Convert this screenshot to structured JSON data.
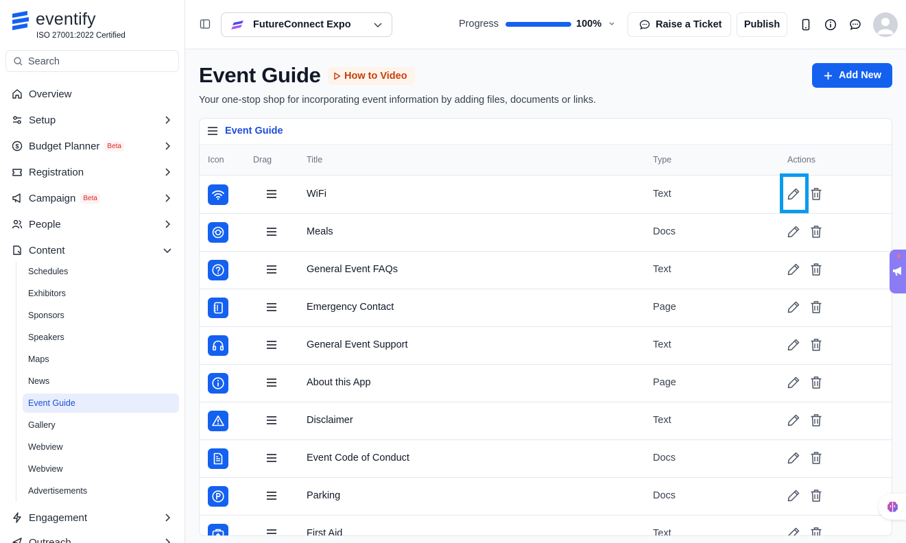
{
  "brand": {
    "name": "eventify",
    "tagline": "ISO 27001:2022 Certified",
    "color": "#1461f0"
  },
  "search": {
    "placeholder": "Search"
  },
  "nav": [
    {
      "label": "Overview",
      "icon": "home-icon",
      "chevron": false
    },
    {
      "label": "Setup",
      "icon": "sliders-icon",
      "chevron": true
    },
    {
      "label": "Budget Planner",
      "icon": "dollar-icon",
      "chevron": true,
      "badge": "Beta"
    },
    {
      "label": "Registration",
      "icon": "ticket-icon",
      "chevron": true
    },
    {
      "label": "Campaign",
      "icon": "megaphone-icon",
      "chevron": true,
      "badge": "Beta"
    },
    {
      "label": "People",
      "icon": "users-icon",
      "chevron": true
    },
    {
      "label": "Content",
      "icon": "file-icon",
      "chevron": true,
      "expanded": true
    },
    {
      "label": "Engagement",
      "icon": "bolt-icon",
      "chevron": true
    },
    {
      "label": "Outreach",
      "icon": "send-icon",
      "chevron": true
    }
  ],
  "content_items": [
    {
      "label": "Schedules"
    },
    {
      "label": "Exhibitors"
    },
    {
      "label": "Sponsors"
    },
    {
      "label": "Speakers"
    },
    {
      "label": "Maps"
    },
    {
      "label": "News"
    },
    {
      "label": "Event Guide",
      "active": true
    },
    {
      "label": "Gallery"
    },
    {
      "label": "Webview"
    },
    {
      "label": "Webview"
    },
    {
      "label": "Advertisements"
    }
  ],
  "topbar": {
    "event_name": "FutureConnect Expo",
    "progress_label": "Progress",
    "progress": 1.0,
    "progress_value": "100%",
    "ticket_label": "Raise a Ticket",
    "publish_label": "Publish"
  },
  "page": {
    "title": "Event Guide",
    "howto_label": "How to Video",
    "subtitle": "Your one-stop shop for incorporating event information by adding files, documents or links.",
    "add_label": "Add New"
  },
  "table": {
    "card_title": "Event Guide",
    "columns": {
      "icon": "Icon",
      "drag": "Drag",
      "title": "Title",
      "type": "Type",
      "actions": "Actions"
    },
    "rows": [
      {
        "title": "WiFi",
        "type": "Text",
        "icon": "wifi-icon"
      },
      {
        "title": "Meals",
        "type": "Docs",
        "icon": "meals-icon"
      },
      {
        "title": "General Event FAQs",
        "type": "Text",
        "icon": "question-icon"
      },
      {
        "title": "Emergency Contact",
        "type": "Page",
        "icon": "contact-book-icon"
      },
      {
        "title": "General Event Support",
        "type": "Text",
        "icon": "headphones-icon"
      },
      {
        "title": "About this App",
        "type": "Page",
        "icon": "info-icon"
      },
      {
        "title": "Disclaimer",
        "type": "Text",
        "icon": "warning-icon"
      },
      {
        "title": "Event Code of Conduct",
        "type": "Docs",
        "icon": "document-icon"
      },
      {
        "title": "Parking",
        "type": "Docs",
        "icon": "parking-icon"
      },
      {
        "title": "First Aid",
        "type": "Text",
        "icon": "first-aid-icon"
      }
    ]
  }
}
